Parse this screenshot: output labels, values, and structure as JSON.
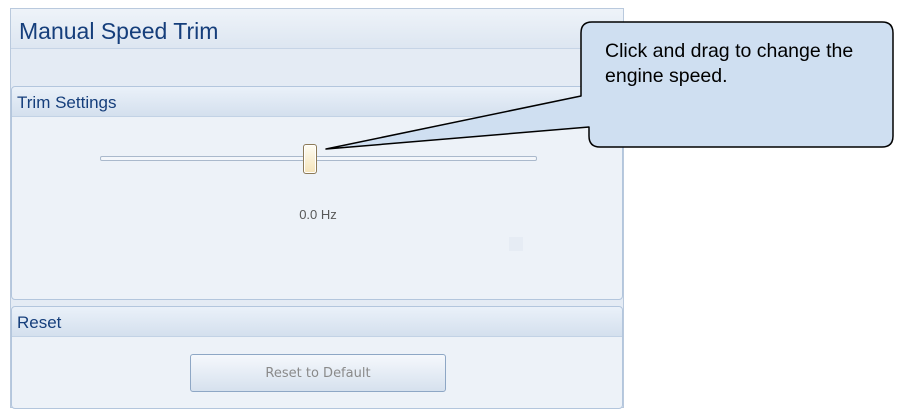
{
  "page": {
    "title": "Manual Speed Trim"
  },
  "trim_settings": {
    "header": "Trim Settings",
    "slider_value_label": "0.0 Hz",
    "slider_position_fraction": 0.48
  },
  "reset": {
    "header": "Reset",
    "button_label": "Reset to Default"
  },
  "callout": {
    "text": "Click and drag to change the engine speed."
  },
  "colors": {
    "title_text": "#153e7b",
    "panel_background": "#e4ebf4",
    "callout_fill": "#cfdff1"
  }
}
